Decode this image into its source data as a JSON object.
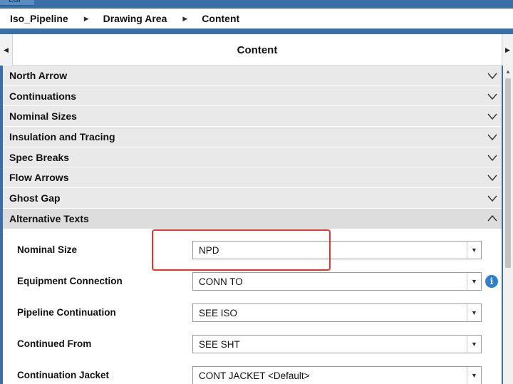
{
  "window": {
    "logo_text": "LOI"
  },
  "breadcrumb": [
    {
      "label": "Iso_Pipeline"
    },
    {
      "label": "Drawing Area"
    },
    {
      "label": "Content"
    }
  ],
  "header": {
    "title": "Content",
    "nav_left_icon": "triangle-left-icon",
    "nav_right_icon": "triangle-right-icon"
  },
  "sections": [
    {
      "label": "North Arrow",
      "state": "collapsed"
    },
    {
      "label": "Continuations",
      "state": "collapsed"
    },
    {
      "label": "Nominal Sizes",
      "state": "collapsed"
    },
    {
      "label": "Insulation and Tracing",
      "state": "collapsed"
    },
    {
      "label": "Spec Breaks",
      "state": "collapsed"
    },
    {
      "label": "Flow Arrows",
      "state": "collapsed"
    },
    {
      "label": "Ghost Gap",
      "state": "collapsed"
    },
    {
      "label": "Alternative Texts",
      "state": "expanded"
    }
  ],
  "alternative_texts": [
    {
      "label": "Nominal Size",
      "value": "NPD",
      "highlighted": true
    },
    {
      "label": "Equipment Connection",
      "value": "CONN TO",
      "info_icon": true
    },
    {
      "label": "Pipeline Continuation",
      "value": "SEE ISO"
    },
    {
      "label": "Continued From",
      "value": "SEE SHT"
    },
    {
      "label": "Continuation Jacket",
      "value": "CONT JACKET <Default>"
    }
  ],
  "colors": {
    "accent_blue": "#3a6fa8",
    "highlight_red": "#e8332f",
    "info_blue": "#2f7fd0"
  }
}
